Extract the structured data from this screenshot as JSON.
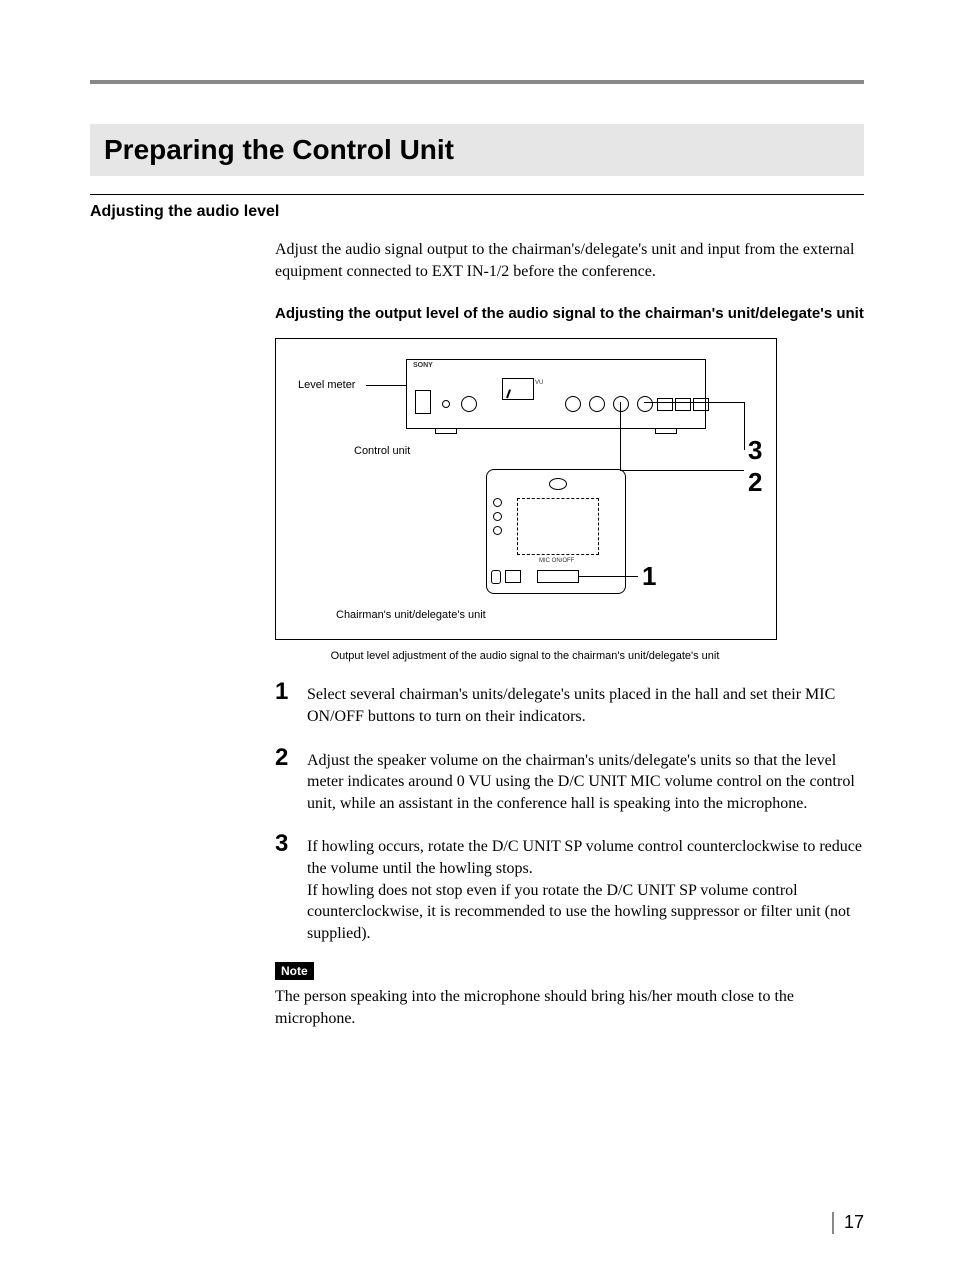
{
  "page": {
    "number": "17",
    "title": "Preparing the Control Unit",
    "section": "Adjusting the audio level",
    "lead": "Adjust the audio signal output to the chairman's/delegate's unit and input from the external equipment connected to EXT IN-1/2 before the conference.",
    "subhead": "Adjusting the output level of the audio signal to the chairman's unit/delegate's unit"
  },
  "diagram": {
    "brand": "SONY",
    "level_meter_label": "Level meter",
    "control_unit_label": "Control unit",
    "delegate_unit_label": "Chairman's unit/delegate's unit",
    "vu": "VU",
    "mic_onoff": "MIC ON/OFF",
    "caption": "Output level adjustment of the audio signal to the chairman's unit/delegate's unit",
    "callouts": [
      "1",
      "2",
      "3"
    ]
  },
  "steps": [
    {
      "n": "1",
      "text": "Select several chairman's units/delegate's units placed in the hall and set their MIC ON/OFF buttons to turn on their indicators."
    },
    {
      "n": "2",
      "text": "Adjust the speaker volume on the  chairman's units/delegate's units so that the level meter indicates around 0 VU using the D/C UNIT MIC volume control on the control unit, while an assistant in the conference hall is speaking into the microphone."
    },
    {
      "n": "3",
      "text": "If howling occurs, rotate the D/C UNIT SP volume control counterclockwise to reduce the volume until the howling stops.\nIf howling does not stop even if you rotate the D/C UNIT SP volume control counterclockwise, it is recommended to use the howling suppressor or filter unit (not supplied)."
    }
  ],
  "note": {
    "badge": "Note",
    "text": "The person speaking into the microphone should bring his/her mouth close to the microphone."
  }
}
